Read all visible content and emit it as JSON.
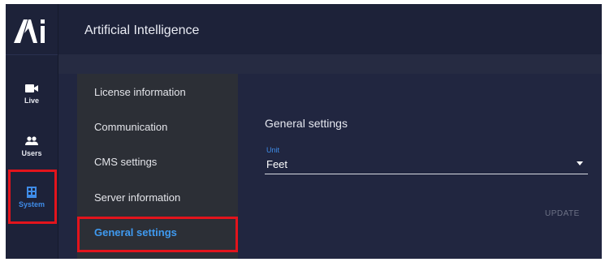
{
  "header": {
    "title": "Artificial Intelligence"
  },
  "sidebar": {
    "items": [
      {
        "label": "Live",
        "icon": "video-camera-icon"
      },
      {
        "label": "Users",
        "icon": "users-icon"
      },
      {
        "label": "System",
        "icon": "system-icon",
        "active": true
      }
    ]
  },
  "settings_menu": {
    "items": [
      {
        "label": "License information"
      },
      {
        "label": "Communication"
      },
      {
        "label": "CMS settings"
      },
      {
        "label": "Server information"
      },
      {
        "label": "General settings",
        "active": true
      }
    ]
  },
  "content": {
    "section_title": "General settings",
    "unit_field": {
      "label": "Unit",
      "value": "Feet"
    },
    "update_label": "UPDATE"
  },
  "colors": {
    "accent": "#3f8ce8",
    "highlight": "#e3141c",
    "background": "#212640"
  }
}
